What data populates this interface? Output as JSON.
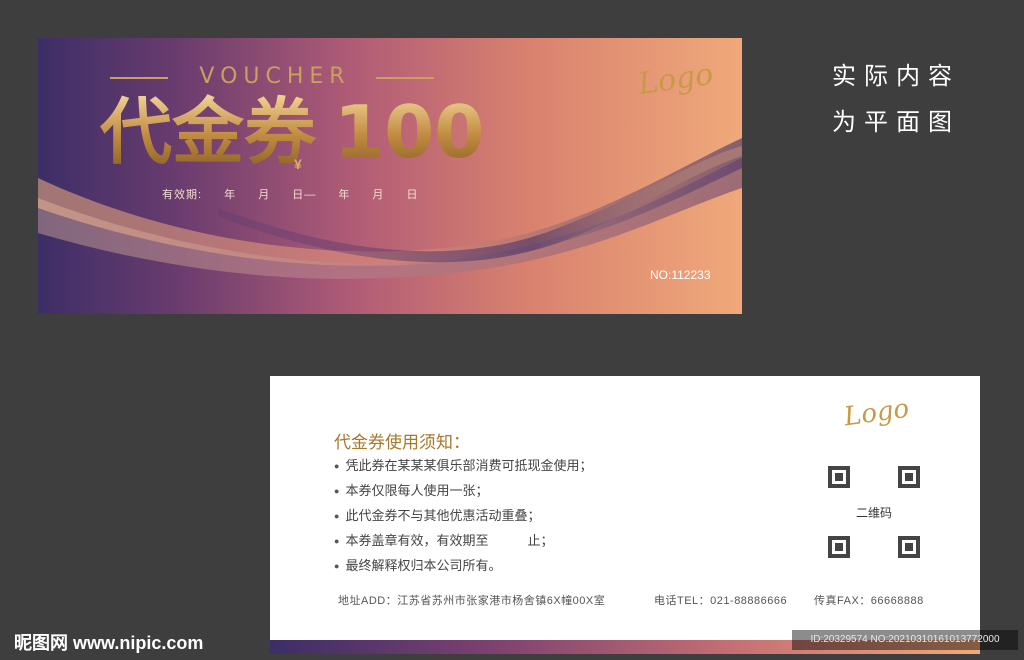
{
  "front": {
    "title_en": "VOUCHER",
    "title_cn": "代金券",
    "currency_symbol": "¥",
    "amount": "100",
    "validity_parts": [
      "有效期:",
      "年",
      "月",
      "日—",
      "年",
      "月",
      "日"
    ],
    "logo": "Logo",
    "serial": "NO:112233"
  },
  "side_note": {
    "line1": "实际内容",
    "line2": "为平面图"
  },
  "back": {
    "logo": "Logo",
    "title": "代金券使用须知：",
    "rules": [
      "凭此券在某某某俱乐部消费可抵现金使用；",
      "本券仅限每人使用一张；",
      "此代金券不与其他优惠活动重叠；",
      "本券盖章有效，有效期至　　　止；",
      "最终解释权归本公司所有。"
    ],
    "qr_label": "二维码",
    "address": "地址ADD：江苏省苏州市张家港市杨舍镇6X幢00X室",
    "phone": "电话TEL：021-88886666",
    "fax": "传真FAX：66668888"
  },
  "watermark": {
    "site": "昵图网 www.nipic.com",
    "id": "ID:20329574 NO:20210310161013772000"
  },
  "colors": {
    "background": "#3e3e3e",
    "gold": "#c9a05d",
    "gradient_start": "#3c2e66",
    "gradient_end": "#f0a97a"
  }
}
